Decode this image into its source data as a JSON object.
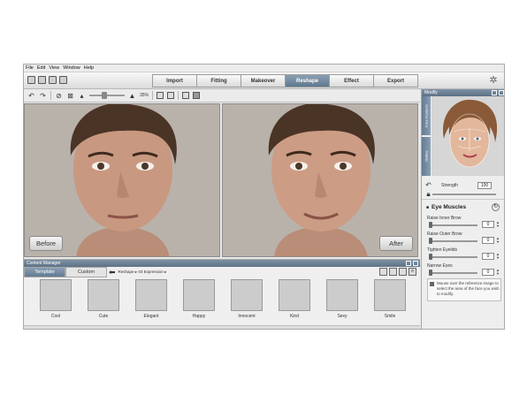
{
  "menu": [
    "File",
    "Edit",
    "View",
    "Window",
    "Help"
  ],
  "tabs": [
    {
      "label": "Import",
      "active": false
    },
    {
      "label": "Fitting",
      "active": false
    },
    {
      "label": "Makeover",
      "active": false
    },
    {
      "label": "Reshape",
      "active": true
    },
    {
      "label": "Effect",
      "active": false
    },
    {
      "label": "Export",
      "active": false
    }
  ],
  "toolbar": {
    "zoom": "35%"
  },
  "panes": {
    "before_label": "Before",
    "after_label": "After"
  },
  "content_manager": {
    "title": "Content Manager",
    "tabs": [
      {
        "label": "Template",
        "active": true
      },
      {
        "label": "Custom",
        "active": false
      }
    ],
    "breadcrumb": "Reshape ▸ 03 Expression ▸",
    "thumbnails": [
      "Cool",
      "Cute",
      "Elegant",
      "Happy",
      "Innocent",
      "Kind",
      "Sexy",
      "Smile"
    ]
  },
  "modify": {
    "title": "Modify",
    "vertical_tabs": [
      "Face Features",
      "Outline"
    ],
    "strength_label": "Strength",
    "strength_value": "100",
    "section_title": "Eye Muscles",
    "controls": [
      {
        "label": "Raise Inner Brow",
        "value": "0"
      },
      {
        "label": "Raise Outer Brow",
        "value": "0"
      },
      {
        "label": "Tighten Eyelids",
        "value": "0"
      },
      {
        "label": "Narrow Eyes",
        "value": "0"
      }
    ],
    "hint": "Mouse over the reference image to select the area of the face you wish to modify."
  }
}
